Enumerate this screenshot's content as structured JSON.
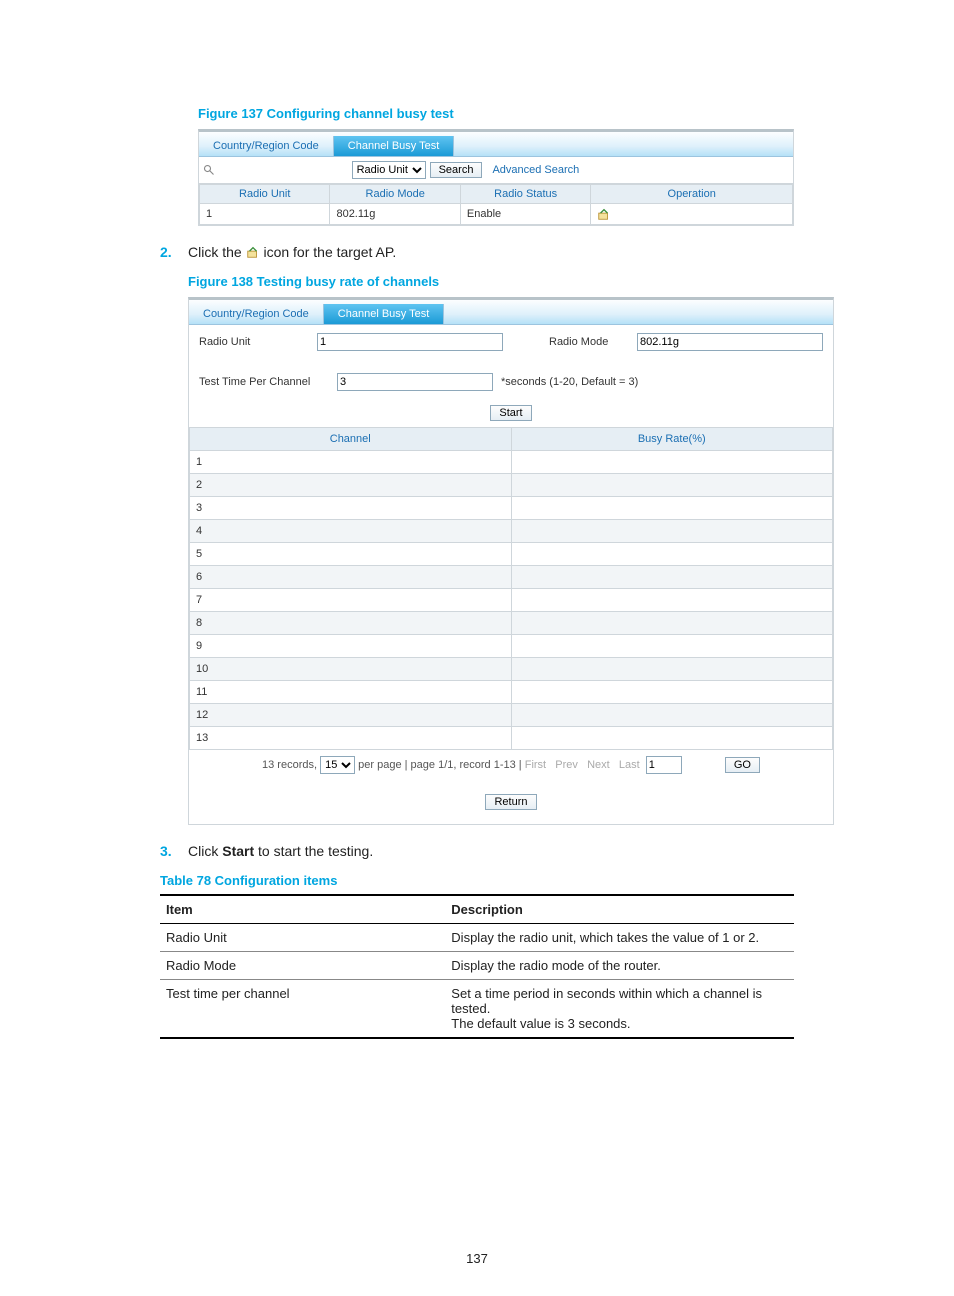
{
  "fig137": {
    "caption": "Figure 137 Configuring channel busy test",
    "tabs": {
      "country": "Country/Region Code",
      "busy": "Channel Busy Test"
    },
    "toolbar": {
      "select_label": "Radio Unit",
      "search_btn": "Search",
      "advanced": "Advanced Search"
    },
    "columns": {
      "unit": "Radio Unit",
      "mode": "Radio Mode",
      "status": "Radio Status",
      "op": "Operation"
    },
    "row": {
      "unit": "1",
      "mode": "802.11g",
      "status": "Enable"
    }
  },
  "step2": {
    "num": "2.",
    "text_before": "Click the ",
    "text_after": " icon for the target AP."
  },
  "fig138": {
    "caption": "Figure 138 Testing busy rate of channels",
    "tabs": {
      "country": "Country/Region Code",
      "busy": "Channel Busy Test"
    },
    "form": {
      "radio_unit_label": "Radio Unit",
      "radio_unit_value": "1",
      "radio_mode_label": "Radio Mode",
      "radio_mode_value": "802.11g",
      "test_time_label": "Test Time Per Channel",
      "test_time_value": "3",
      "test_time_hint": "*seconds (1-20, Default = 3)",
      "start_btn": "Start"
    },
    "columns": {
      "channel": "Channel",
      "busy": "Busy Rate(%)"
    },
    "rows": [
      "1",
      "2",
      "3",
      "4",
      "5",
      "6",
      "7",
      "8",
      "9",
      "10",
      "11",
      "12",
      "13"
    ],
    "pager": {
      "records": "13 records,",
      "per_page_value": "15",
      "per_page_suffix": "per page | page 1/1, record 1-13 |",
      "first": "First",
      "prev": "Prev",
      "next": "Next",
      "last": "Last",
      "page_input": "1",
      "go": "GO"
    },
    "return_btn": "Return"
  },
  "step3": {
    "num": "3.",
    "text_before": "Click ",
    "bold": "Start",
    "text_after": " to start the testing."
  },
  "table78": {
    "caption": "Table 78 Configuration items",
    "head": {
      "item": "Item",
      "desc": "Description"
    },
    "rows": [
      {
        "item": "Radio Unit",
        "desc": "Display the radio unit, which takes the value of 1 or 2."
      },
      {
        "item": "Radio Mode",
        "desc": "Display the radio mode of the router."
      },
      {
        "item": "Test time per channel",
        "desc": "Set a time period in seconds within which a channel is tested.\nThe default value is 3 seconds."
      }
    ]
  },
  "page_number": "137"
}
